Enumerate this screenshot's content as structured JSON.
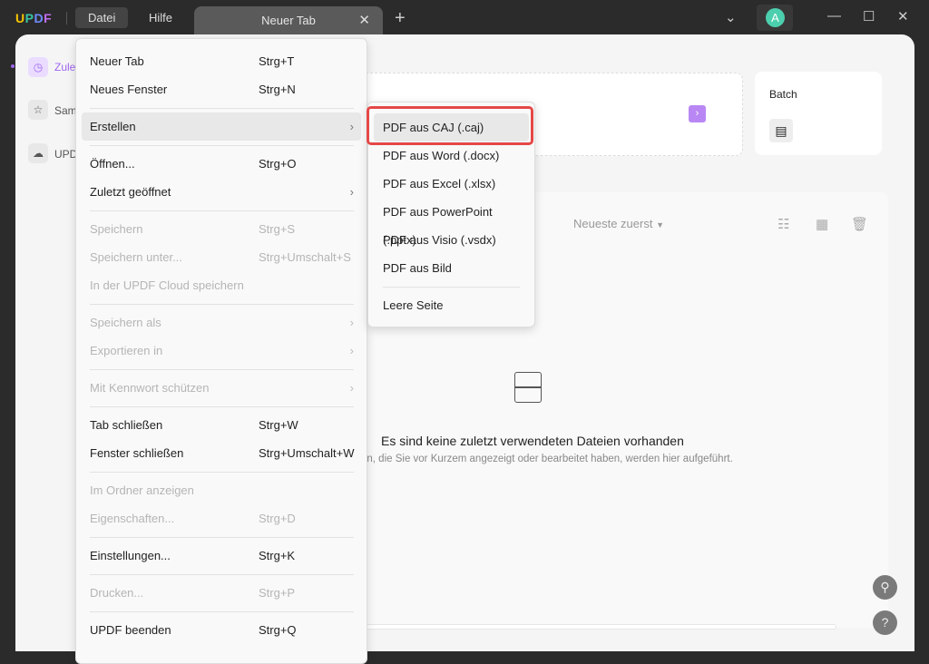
{
  "app": {
    "logo": "UPDF",
    "menubar": [
      "Datei",
      "Hilfe"
    ],
    "tab": {
      "label": "Neuer Tab"
    },
    "avatar": "A"
  },
  "sidebar": {
    "items": [
      {
        "label": "Zule",
        "icon": "clock-icon",
        "active": true
      },
      {
        "label": "Sam",
        "icon": "star-icon"
      },
      {
        "label": "UPD",
        "icon": "cloud-icon"
      }
    ]
  },
  "batch": {
    "title": "Batch"
  },
  "list": {
    "sort": "Neueste zuerst",
    "empty_title": "Es sind keine zuletzt verwendeten Dateien vorhanden",
    "empty_sub": "en, die Sie vor Kurzem angezeigt oder bearbeitet haben, werden hier aufgeführt."
  },
  "menu": [
    {
      "label": "Neuer Tab",
      "shortcut": "Strg+T"
    },
    {
      "label": "Neues Fenster",
      "shortcut": "Strg+N"
    },
    {
      "divider": true
    },
    {
      "label": "Erstellen",
      "submenu": true,
      "highlight": true
    },
    {
      "divider": true
    },
    {
      "label": "Öffnen...",
      "shortcut": "Strg+O"
    },
    {
      "label": "Zuletzt geöffnet",
      "submenu": true
    },
    {
      "divider": true
    },
    {
      "label": "Speichern",
      "shortcut": "Strg+S",
      "disabled": true
    },
    {
      "label": "Speichern unter...",
      "shortcut": "Strg+Umschalt+S",
      "disabled": true
    },
    {
      "label": "In der UPDF Cloud speichern",
      "disabled": true
    },
    {
      "divider": true
    },
    {
      "label": "Speichern als",
      "submenu": true,
      "disabled": true
    },
    {
      "label": "Exportieren in",
      "submenu": true,
      "disabled": true
    },
    {
      "divider": true
    },
    {
      "label": "Mit Kennwort schützen",
      "submenu": true,
      "disabled": true
    },
    {
      "divider": true
    },
    {
      "label": "Tab schließen",
      "shortcut": "Strg+W"
    },
    {
      "label": "Fenster schließen",
      "shortcut": "Strg+Umschalt+W"
    },
    {
      "divider": true
    },
    {
      "label": "Im Ordner anzeigen",
      "disabled": true
    },
    {
      "label": "Eigenschaften...",
      "shortcut": "Strg+D",
      "disabled": true
    },
    {
      "divider": true
    },
    {
      "label": "Einstellungen...",
      "shortcut": "Strg+K"
    },
    {
      "divider": true
    },
    {
      "label": "Drucken...",
      "shortcut": "Strg+P",
      "disabled": true
    },
    {
      "divider": true
    },
    {
      "label": "UPDF beenden",
      "shortcut": "Strg+Q"
    }
  ],
  "submenu": [
    {
      "label": "PDF aus CAJ (.caj)",
      "highlight": true
    },
    {
      "label": "PDF aus Word (.docx)"
    },
    {
      "label": "PDF aus Excel (.xlsx)"
    },
    {
      "label": "PDF aus PowerPoint (.pptx)"
    },
    {
      "label": "PDF aus Visio (.vsdx)"
    },
    {
      "label": "PDF aus Bild"
    },
    {
      "divider": true
    },
    {
      "label": "Leere Seite"
    }
  ],
  "colors": {
    "accent": "#9f66f0",
    "highlight_box": "#e54848",
    "avatar": "#4ccfae"
  }
}
